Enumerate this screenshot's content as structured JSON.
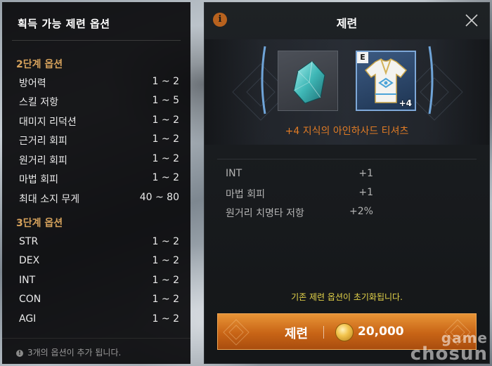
{
  "left_panel": {
    "title": "획득 가능 제련 옵션",
    "sections": [
      {
        "title": "2단계 옵션",
        "options": [
          {
            "name": "방어력",
            "range": "1 ~ 2"
          },
          {
            "name": "스킬 저항",
            "range": "1 ~ 5"
          },
          {
            "name": "대미지 리덕션",
            "range": "1 ~ 2"
          },
          {
            "name": "근거리 회피",
            "range": "1 ~ 2"
          },
          {
            "name": "원거리 회피",
            "range": "1 ~ 2"
          },
          {
            "name": "마법 회피",
            "range": "1 ~ 2"
          },
          {
            "name": "최대 소지 무게",
            "range": "40 ~ 80"
          }
        ]
      },
      {
        "title": "3단계 옵션",
        "options": [
          {
            "name": "STR",
            "range": "1 ~ 2"
          },
          {
            "name": "DEX",
            "range": "1 ~ 2"
          },
          {
            "name": "INT",
            "range": "1 ~ 2"
          },
          {
            "name": "CON",
            "range": "1 ~ 2"
          },
          {
            "name": "AGI",
            "range": "1 ~ 2"
          }
        ]
      }
    ],
    "footer_note": "3개의 옵션이 추가 됩니다.",
    "footer_icon": "!"
  },
  "dialog": {
    "title": "제련",
    "info_icon": "i",
    "item": {
      "grade": "E",
      "enchant": "+4",
      "name": "+4 지식의 아인하사드 티셔츠"
    },
    "stats": [
      {
        "name": "INT",
        "value": "+1"
      },
      {
        "name": "마법 회피",
        "value": "+1"
      },
      {
        "name": "원거리 치명타 저항",
        "value": "+2%"
      }
    ],
    "warning": "기존 제련 옵션이 초기화됩니다.",
    "button": {
      "label": "제련",
      "cost": "20,000"
    }
  },
  "watermark": {
    "line1": "game",
    "line2": "chosun"
  },
  "colors": {
    "section_title": "#d6a25c",
    "item_name": "#e07b25",
    "warning": "#e6d54a",
    "button": "#c86416",
    "gear_border": "#7ea8d8"
  }
}
